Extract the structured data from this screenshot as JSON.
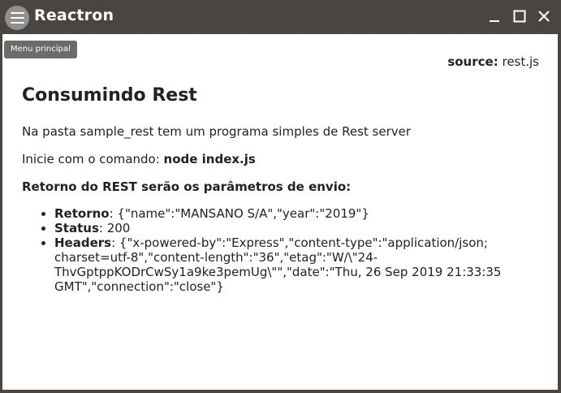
{
  "window": {
    "title": "Reactron",
    "menu_icon": "hamburger-menu-icon",
    "controls": [
      "minimize-icon",
      "maximize-icon",
      "close-icon"
    ]
  },
  "tooltip": {
    "text": "Menu principal"
  },
  "source": {
    "label": "source:",
    "value": "rest.js"
  },
  "main": {
    "heading": "Consumindo Rest",
    "intro": "Na pasta sample_rest tem um programa simples de Rest server",
    "command_prefix": "Inicie com o comando: ",
    "command": "node index.js",
    "return_heading": "Retorno do REST serão os parâmetros de envio:",
    "items": [
      {
        "label": "Retorno",
        "value": ": {\"name\":\"MANSANO S/A\",\"year\":\"2019\"}"
      },
      {
        "label": "Status",
        "value": ": 200"
      },
      {
        "label": "Headers",
        "value": ": {\"x-powered-by\":\"Express\",\"content-type\":\"application/json; charset=utf-8\",\"content-length\":\"36\",\"etag\":\"W/\\\"24-ThvGptppKODrCwSy1a9ke3pemUg\\\"\",\"date\":\"Thu, 26 Sep 2019 21:33:35 GMT\",\"connection\":\"close\"}"
      }
    ]
  },
  "colors": {
    "titlebar": "#4a4541",
    "menu_button": "#8f8f8f",
    "content_bg": "#ffffff",
    "tooltip_bg": "#6b6b6b",
    "text": "#222222"
  }
}
